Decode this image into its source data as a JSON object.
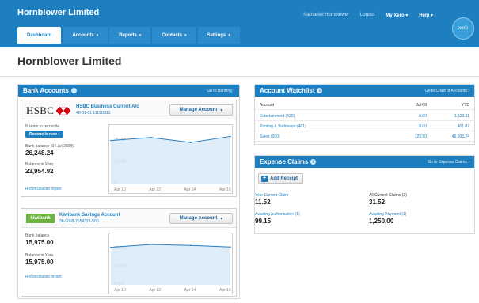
{
  "header": {
    "org_name": "Hornblower Limited",
    "user_name": "Nathaniel Hornblower",
    "logout": "Logout",
    "my_xero": "My Xero",
    "help": "Help",
    "logo_text": "xero",
    "tabs": [
      {
        "label": "Dashboard"
      },
      {
        "label": "Accounts"
      },
      {
        "label": "Reports"
      },
      {
        "label": "Contacts"
      },
      {
        "label": "Settings"
      }
    ],
    "caret": "▾"
  },
  "page_title": "Hornblower Limited",
  "bank_accounts": {
    "title": "Bank Accounts",
    "link": "Go to Banking ›",
    "info_icon": "i",
    "manage_label": "Manage Account",
    "hsbc": {
      "logo_text": "HSBC",
      "name": "HSBC Business Current A/c",
      "number": "40-01-01 111111111",
      "items_to_reconcile": "8 items to reconcile",
      "reconcile_button": "Reconcile now ›",
      "bank_balance_label": "Bank balance (04 Jul 2008)",
      "bank_balance": "26,248.24",
      "xero_balance_label": "Balance in Xero",
      "xero_balance": "23,954.92",
      "report_link": "Reconciliation report",
      "chart_data": {
        "type": "line",
        "categories": [
          "Apr 10",
          "Apr 12",
          "Apr 14",
          "Apr 16"
        ],
        "y_ticks": [
          "20,000",
          "10,000",
          "0"
        ],
        "ylim": [
          0,
          26000
        ],
        "values": [
          21500,
          23000,
          20500,
          23500
        ],
        "color": "#2a7fc4",
        "fill": "#d6e8f6"
      }
    },
    "kiwi": {
      "logo_text": "kiwibank",
      "name": "Kiwibank Savings Account",
      "number": "38-9008-7654321-500",
      "bank_balance_label": "Bank balance",
      "bank_balance": "15,975.00",
      "xero_balance_label": "Balance in Xero",
      "xero_balance": "15,975.00",
      "report_link": "Reconciliation report",
      "chart_data": {
        "type": "line",
        "categories": [
          "Apr 10",
          "Apr 12",
          "Apr 14",
          "Apr 16"
        ],
        "y_ticks": [
          "15,000",
          "10,000",
          "5,000"
        ],
        "ylim": [
          0,
          19000
        ],
        "values": [
          15800,
          17000,
          16600,
          15900
        ],
        "color": "#2a7fc4",
        "fill": "#d6e8f6"
      }
    }
  },
  "watchlist": {
    "title": "Account Watchlist",
    "link": "Go to Chart of Accounts ›",
    "columns": [
      "Account",
      "Jul-08",
      "YTD"
    ],
    "rows": [
      {
        "account": "Entertainment (420)",
        "month": "0.00",
        "ytd": "1,623.11"
      },
      {
        "account": "Printing & Stationery (461)",
        "month": "0.00",
        "ytd": "401.07"
      },
      {
        "account": "Sales (200)",
        "month": "123.50",
        "ytd": "46,603.24"
      }
    ]
  },
  "expense_claims": {
    "title": "Expense Claims",
    "link": "Go to Expense Claims ›",
    "add_receipt": "Add Receipt",
    "plus": "+",
    "current_claim_label": "Your Current Claim",
    "current_claim": "11.52",
    "all_claims_label": "All Current Claims (2)",
    "all_claims": "31.52",
    "awaiting_auth_label": "Awaiting Authorisation (1)",
    "awaiting_auth": "99.15",
    "awaiting_payment_label": "Awaiting Payment (1)",
    "awaiting_payment": "1,250.00"
  }
}
